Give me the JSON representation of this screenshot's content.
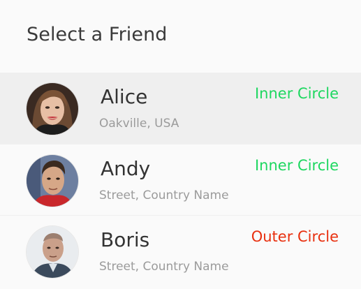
{
  "header": {
    "title": "Select a Friend"
  },
  "friends": [
    {
      "name": "Alice",
      "address": "Oakville, USA",
      "circle": "Inner Circle",
      "circle_color": "#1ed760",
      "avatar": "alice-photo",
      "selected": true
    },
    {
      "name": "Andy",
      "address": "Street, Country Name",
      "circle": "Inner Circle",
      "circle_color": "#1ed760",
      "avatar": "andy-photo",
      "selected": false
    },
    {
      "name": "Boris",
      "address": "Street, Country Name",
      "circle": "Outer Circle",
      "circle_color": "#e8300f",
      "avatar": "boris-photo",
      "selected": false
    }
  ]
}
